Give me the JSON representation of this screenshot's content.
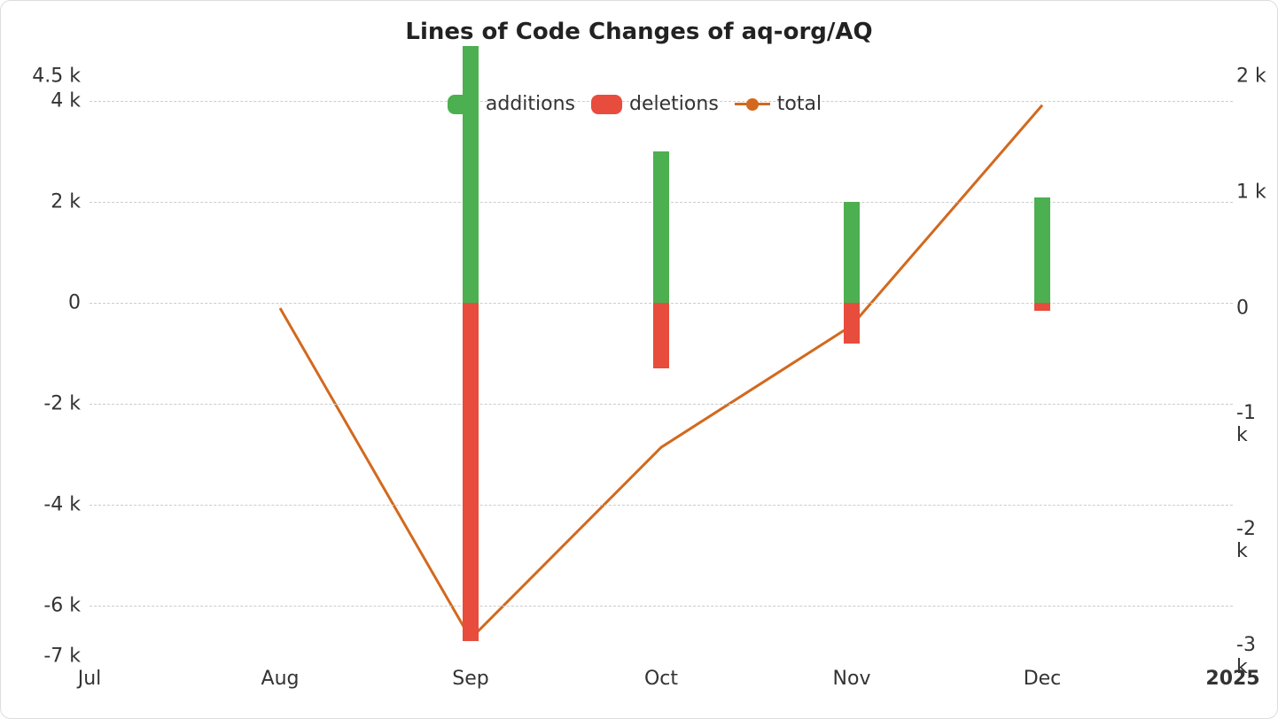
{
  "chart_data": {
    "type": "bar+line",
    "title": "Lines of Code Changes of aq-org/AQ",
    "x_categories": [
      "Jul",
      "Aug",
      "Sep",
      "Oct",
      "Nov",
      "Dec",
      "2025"
    ],
    "series": [
      {
        "name": "additions",
        "type": "bar",
        "color": "#4caf50",
        "values": [
          null,
          null,
          5100,
          3000,
          2000,
          2100,
          null
        ]
      },
      {
        "name": "deletions",
        "type": "bar",
        "color": "#e74c3c",
        "values": [
          null,
          null,
          -6700,
          -1300,
          -800,
          -150,
          null
        ]
      },
      {
        "name": "total",
        "type": "line",
        "color": "#d2691e",
        "values": [
          null,
          0,
          -2850,
          -1200,
          -150,
          1750,
          null
        ]
      }
    ],
    "y_left": {
      "min": -7000,
      "max": 4500,
      "ticks": [
        -7000,
        -6000,
        -4000,
        -2000,
        0,
        2000,
        4000,
        4500
      ],
      "tick_labels": [
        "-7 k",
        "-6 k",
        "-4 k",
        "-2 k",
        "0",
        "2 k",
        "4 k",
        "4.5 k"
      ]
    },
    "y_right": {
      "min": -3000,
      "max": 2000,
      "ticks": [
        -3000,
        -2000,
        -1000,
        0,
        1000,
        2000
      ],
      "tick_labels": [
        "-3 k",
        "-2 k",
        "-1 k",
        "0",
        "1 k",
        "2 k"
      ]
    },
    "legend": [
      "additions",
      "deletions",
      "total"
    ]
  }
}
